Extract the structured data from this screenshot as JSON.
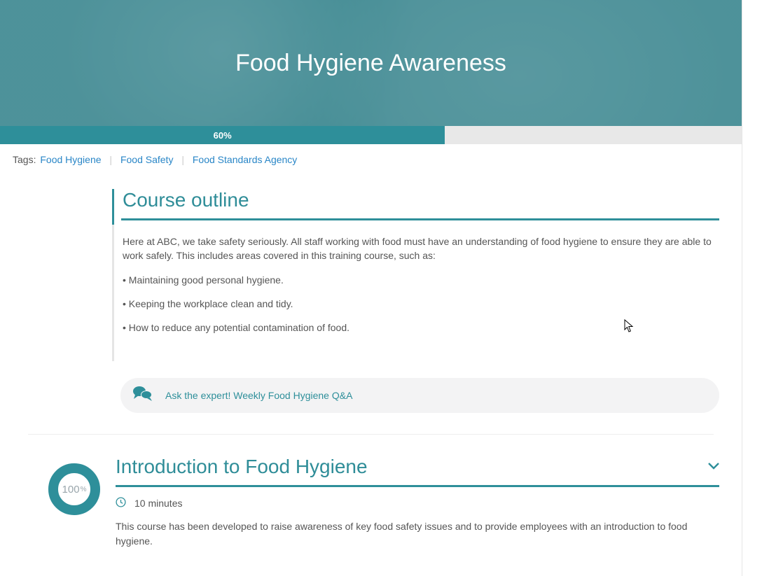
{
  "hero": {
    "title": "Food Hygiene Awareness"
  },
  "progress": {
    "percent": 60,
    "label": "60%"
  },
  "tags": {
    "label": "Tags:",
    "items": [
      "Food Hygiene",
      "Food Safety",
      "Food Standards Agency"
    ]
  },
  "outline": {
    "heading": "Course outline",
    "intro": "Here at ABC, we take safety seriously. All staff working with food must have an understanding of food hygiene to ensure they are able to work safely. This includes areas covered in this training course, such as:",
    "bullets": [
      "• Maintaining good personal hygiene.",
      "• Keeping the workplace clean and tidy.",
      "• How to reduce any potential contamination of food."
    ],
    "ask_expert": "Ask the expert! Weekly Food Hygiene Q&A"
  },
  "module": {
    "title": "Introduction to Food Hygiene",
    "ring_value": "100",
    "ring_pct": "%",
    "duration": "10 minutes",
    "description": "This course has been developed to raise awareness of key food safety issues and to provide employees with an introduction to food hygiene."
  },
  "colors": {
    "accent": "#2e8f9a"
  }
}
